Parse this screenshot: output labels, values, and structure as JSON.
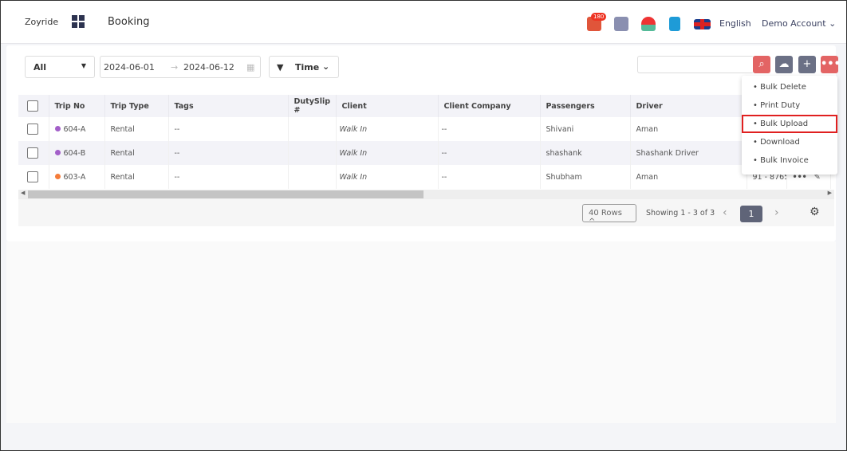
{
  "header": {
    "brand": "Zoyride",
    "title": "Booking",
    "notification_count": "180",
    "language": "English",
    "account": "Demo Account"
  },
  "toolbar": {
    "filter_select": "All",
    "date_from": "2024-06-01",
    "date_to": "2024-06-12",
    "time_filter": "Time",
    "search_placeholder": ""
  },
  "menu": {
    "items": [
      {
        "label": "Bulk Delete"
      },
      {
        "label": "Print Duty"
      },
      {
        "label": "Bulk Upload",
        "highlighted": true
      },
      {
        "label": "Download"
      },
      {
        "label": "Bulk Invoice"
      }
    ]
  },
  "table": {
    "columns": [
      "Trip No",
      "Trip Type",
      "Tags",
      "DutySlip #",
      "Client",
      "Client Company",
      "Passengers",
      "Driver"
    ],
    "rows": [
      {
        "trip_no": "604-A",
        "status_color": "#a35fc9",
        "trip_type": "Rental",
        "tags": "--",
        "dutyslip": "",
        "client": "Walk In",
        "client_company": "--",
        "passengers": "Shivani",
        "driver": "Aman",
        "phone": ""
      },
      {
        "trip_no": "604-B",
        "status_color": "#a35fc9",
        "trip_type": "Rental",
        "tags": "--",
        "dutyslip": "",
        "client": "Walk In",
        "client_company": "--",
        "passengers": "shashank",
        "driver": "Shashank Driver",
        "phone": ""
      },
      {
        "trip_no": "603-A",
        "status_color": "#f57c3a",
        "trip_type": "Rental",
        "tags": "--",
        "dutyslip": "",
        "client": "Walk In",
        "client_company": "--",
        "passengers": "Shubham",
        "driver": "Aman",
        "phone": "91 - 87658"
      }
    ]
  },
  "pagination": {
    "rows_per_page": "40 Rows",
    "showing": "Showing  1 - 3 of 3",
    "current_page": "1"
  },
  "colors": {
    "accent_red": "#e36464",
    "button_gray": "#6b7085",
    "highlight": "#e02020"
  }
}
